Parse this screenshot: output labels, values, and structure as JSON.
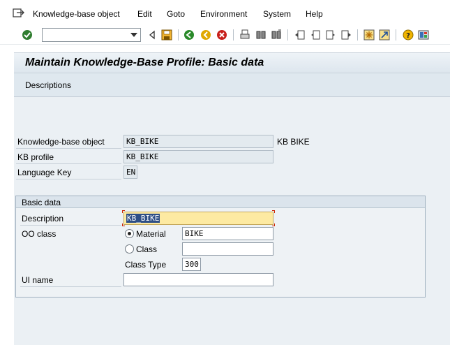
{
  "menu": {
    "items": [
      {
        "label": "Knowledge-base object",
        "icon": "exit-menu-icon"
      },
      {
        "label": "Edit"
      },
      {
        "label": "Goto"
      },
      {
        "label": "Environment"
      },
      {
        "label": "System"
      },
      {
        "label": "Help"
      }
    ]
  },
  "toolbar": {
    "command_field_value": "",
    "icons": [
      "enter-icon",
      "command-dropdown-icon",
      "back-arrow-icon",
      "save-icon",
      "back-icon",
      "exit-icon",
      "cancel-icon",
      "print-icon",
      "find-icon",
      "find-next-icon",
      "first-page-icon",
      "previous-page-icon",
      "next-page-icon",
      "last-page-icon",
      "create-session-icon",
      "shortcut-icon",
      "help-icon",
      "layout-icon"
    ],
    "colors": {
      "enter": "#2f7d2f",
      "back": "#2a8a2a",
      "exit": "#e0a800",
      "cancel": "#c8201b",
      "help": "#f0b400"
    }
  },
  "title": "Maintain Knowledge-Base Profile: Basic data",
  "app_toolbar": {
    "descriptions_label": "Descriptions"
  },
  "header_fields": {
    "kb_object": {
      "label": "Knowledge-base object",
      "value": "KB_BIKE",
      "text": "KB BIKE"
    },
    "kb_profile": {
      "label": "KB profile",
      "value": "KB_BIKE"
    },
    "language_key": {
      "label": "Language Key",
      "value": "EN"
    }
  },
  "basic_data": {
    "group_title": "Basic data",
    "description": {
      "label": "Description",
      "value": "KB_BIKE"
    },
    "oo_class": {
      "label": "OO class",
      "material_label": "Material",
      "material_value": "BIKE",
      "material_selected": true,
      "class_label": "Class",
      "class_value": "",
      "class_type_label": "Class Type",
      "class_type_value": "300"
    },
    "ui_name": {
      "label": "UI name",
      "value": ""
    }
  }
}
